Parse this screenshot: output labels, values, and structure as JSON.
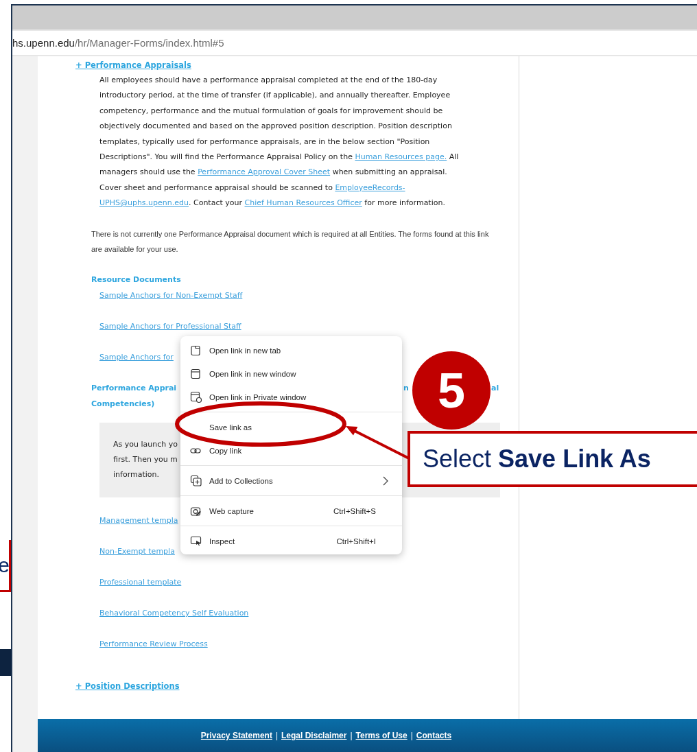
{
  "left_strip": {
    "callout_text": "e"
  },
  "browser": {
    "address": {
      "host": "hs.upenn.edu",
      "path": "/hr/Manager-Forms/index.html#5"
    }
  },
  "content": {
    "section_heading": "+ Performance Appraisals",
    "paragraph": [
      {
        "kind": "text",
        "text": "All employees should have a performance appraisal completed at the end of the 180-day introductory period, at the time of transfer (if applicable), and annually thereafter. Employee competency, performance and the mutual formulation of goals for improvement should be objectively documented and based on the approved position description. Position description templates, typically used for performance appraisals, are in the below section \"Position Descriptions\". You will find the Performance Appraisal Policy on the "
      },
      {
        "kind": "link",
        "text": "Human Resources page."
      },
      {
        "kind": "text",
        "text": " All managers should use the "
      },
      {
        "kind": "link",
        "text": "Performance Approval Cover Sheet"
      },
      {
        "kind": "text",
        "text": " when submitting an appraisal. Cover sheet and performance appraisal should be scanned to "
      },
      {
        "kind": "link",
        "text": "EmployeeRecords-"
      },
      {
        "kind": "link",
        "text": "UPHS@uphs.upenn.edu"
      },
      {
        "kind": "text",
        "text": ". Contact your "
      },
      {
        "kind": "link",
        "text": "Chief Human Resources Officer"
      },
      {
        "kind": "text",
        "text": " for more information."
      }
    ],
    "note": "There is not currently one Performance Appraisal document which is required at all Entities. The forms found at this link are available for your use.",
    "resource_heading": "Resource Documents",
    "resource_links": [
      "Sample Anchors for Non-Exempt Staff",
      "Sample Anchors for Professional Staff",
      "Sample Anchors for"
    ],
    "forms_heading": {
      "line_1_start": "Performance Apprai",
      "line_1_middle": "n",
      "line_1_end": "al",
      "line_2": "Competencies)"
    },
    "info_box": {
      "lines": [
        "As you launch yo",
        "first. Then you m",
        "information."
      ]
    },
    "template_links": [
      "Management templa",
      "Non-Exempt templa",
      "Professional template",
      "Behavioral Competency Self Evaluation",
      "Performance Review Process"
    ],
    "position_heading": "+ Position Descriptions"
  },
  "footer": [
    {
      "kind": "link",
      "text": "Privacy Statement"
    },
    {
      "kind": "separator",
      "text": "|"
    },
    {
      "kind": "link",
      "text": "Legal Disclaimer"
    },
    {
      "kind": "separator",
      "text": "|"
    },
    {
      "kind": "link",
      "text": "Terms of Use"
    },
    {
      "kind": "separator",
      "text": "|"
    },
    {
      "kind": "link",
      "text": "Contacts"
    }
  ],
  "context_menu": [
    {
      "kind": "tab",
      "label": "Open link in new tab",
      "separator_after": false,
      "submenu": false
    },
    {
      "kind": "window",
      "label": "Open link in new window",
      "separator_after": false,
      "submenu": false
    },
    {
      "kind": "private",
      "label": "Open link in Private window",
      "separator_after": true,
      "submenu": false
    },
    {
      "kind": "save",
      "label": "Save link as",
      "separator_after": false,
      "submenu": false
    },
    {
      "kind": "link",
      "label": "Copy link",
      "separator_after": true,
      "submenu": false
    },
    {
      "kind": "collections",
      "label": "Add to Collections",
      "separator_after": true,
      "submenu": true
    },
    {
      "kind": "capture",
      "label": "Web capture",
      "shortcut": "Ctrl+Shift+S",
      "separator_after": true,
      "submenu": false
    },
    {
      "kind": "inspect",
      "label": "Inspect",
      "shortcut": "Ctrl+Shift+I",
      "separator_after": false,
      "submenu": false
    }
  ],
  "annotation": {
    "step": "5",
    "callout": "Select **Save Link As**"
  }
}
